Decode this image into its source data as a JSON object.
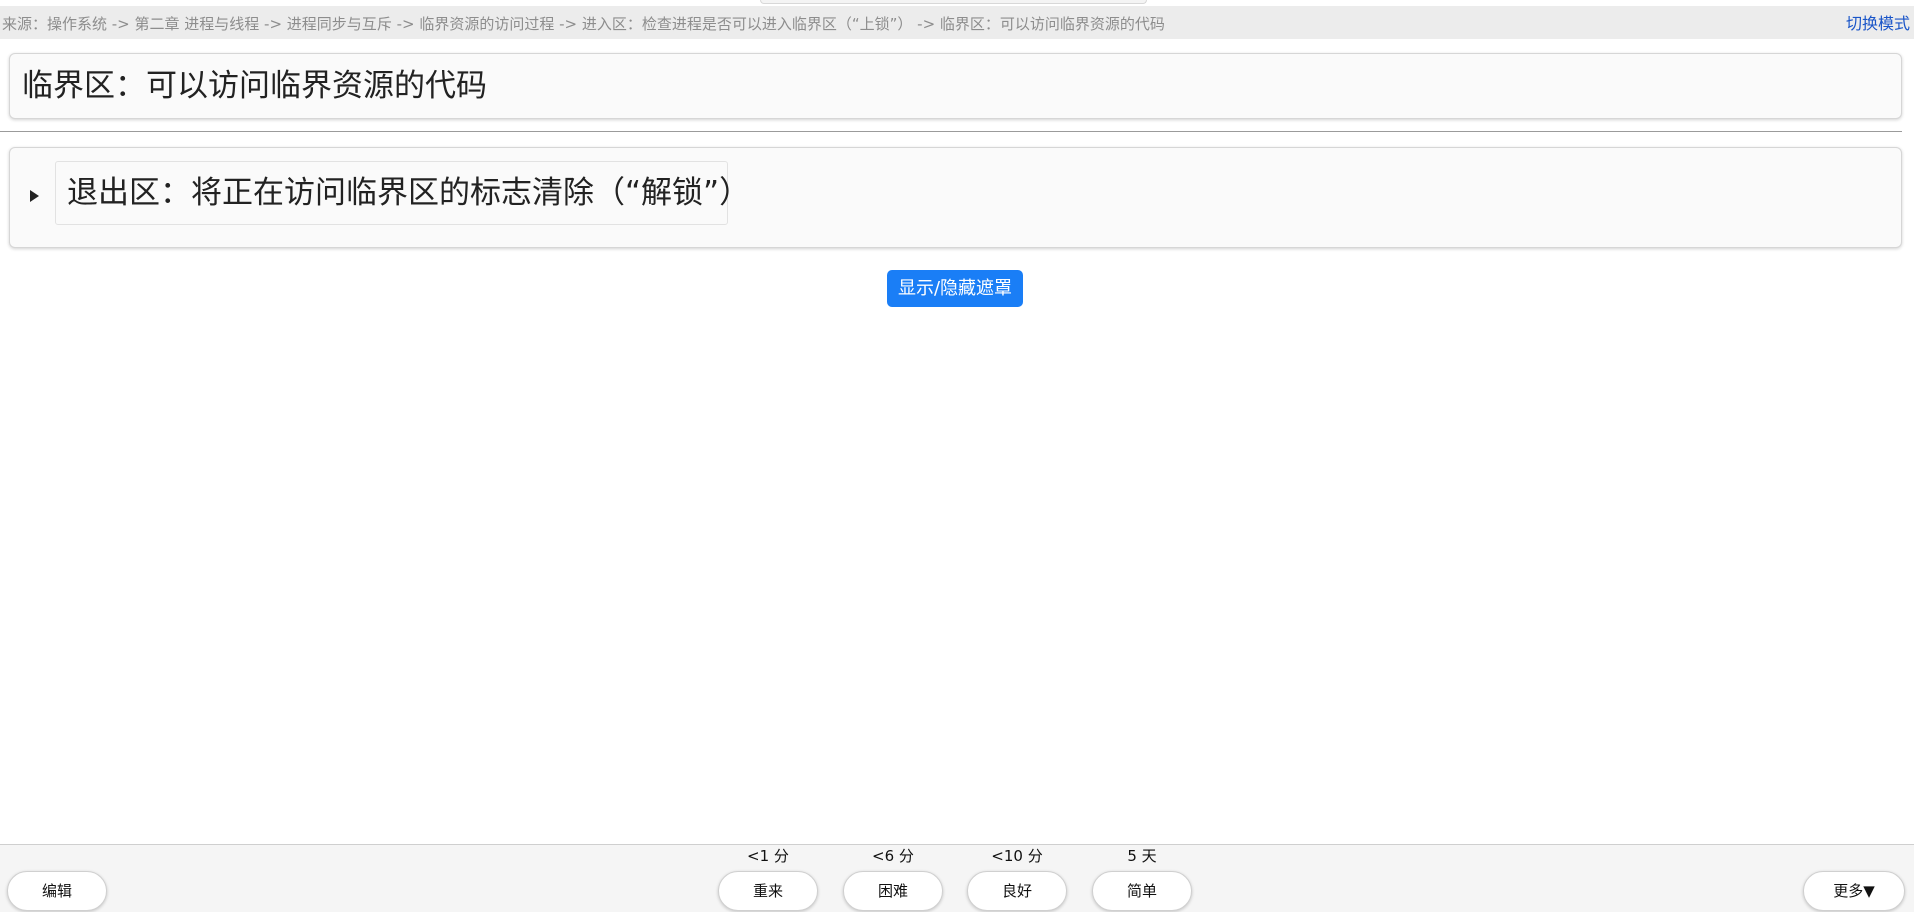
{
  "header": {
    "breadcrumb": "来源：操作系统 -> 第二章 进程与线程 -> 进程同步与互斥 -> 临界资源的访问过程 -> 进入区：检查进程是否可以进入临界区（“上锁”） -> 临界区：可以访问临界资源的代码",
    "switch_mode": "切换模式"
  },
  "card": {
    "title": "临界区：可以访问临界资源的代码",
    "summary": "退出区：将正在访问临界区的标志清除（“解锁”）"
  },
  "mask_toggle_label": "显示/隐藏遮罩",
  "footer": {
    "edit_label": "编辑",
    "more_label": "更多▼",
    "answers": [
      {
        "interval": "<1 分",
        "label": "重来"
      },
      {
        "interval": "<6 分",
        "label": "困难"
      },
      {
        "interval": "<10 分",
        "label": "良好"
      },
      {
        "interval": "5 天",
        "label": "简单"
      }
    ]
  },
  "colors": {
    "accent_button": "#1a7ef6",
    "link": "#1a55c8"
  }
}
